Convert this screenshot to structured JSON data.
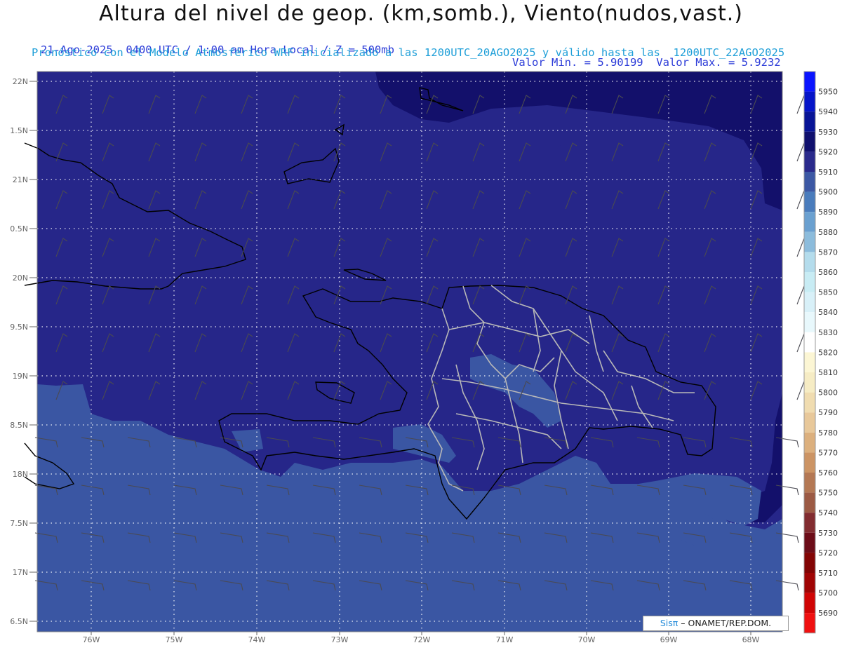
{
  "header": {
    "title": "Altura del nivel de geop. (km,somb.), Viento(nudos,vast.)",
    "left_info": "21-Ago-2025  0400 UTC / 1:00 am Hora Local / Z = 500mb",
    "right_info": "Valor Min. = 5.90199  Valor Max. = 5.9232",
    "model_info": "Pronóstico con el Modelo Atmosférico WRF inicializado a las 1200UTC_20AGO2025 y válido hasta las  1200UTC_22AGO2025"
  },
  "map": {
    "lat_labels": [
      "22N",
      "1.5N",
      "21N",
      "0.5N",
      "20N",
      "9.5N",
      "19N",
      "8.5N",
      "18N",
      "7.5N",
      "17N",
      "6.5N"
    ],
    "lon_labels": [
      "76W",
      "75W",
      "74W",
      "73W",
      "72W",
      "71W",
      "70W",
      "69W",
      "68W"
    ]
  },
  "colorbar": {
    "labels": [
      "5950",
      "5940",
      "5930",
      "5920",
      "5910",
      "5900",
      "5890",
      "5880",
      "5870",
      "5860",
      "5850",
      "5840",
      "5830",
      "5820",
      "5810",
      "5800",
      "5790",
      "5780",
      "5770",
      "5760",
      "5750",
      "5740",
      "5730",
      "5720",
      "5710",
      "5700",
      "5690"
    ],
    "colors": [
      "#0a14ff",
      "#0514c8",
      "#081496",
      "#10106e",
      "#2a2a8c",
      "#3c58a4",
      "#4a7cbc",
      "#6aa0d0",
      "#8cbcdc",
      "#b4dcec",
      "#c8ecf4",
      "#d8f0f8",
      "#e8f8fc",
      "#ffffff",
      "#fcf6d4",
      "#f6ecc4",
      "#f0dcb0",
      "#e8c89a",
      "#dcb07e",
      "#cc9464",
      "#b47854",
      "#9c5a44",
      "#822c30",
      "#6c0c18",
      "#820404",
      "#a00404",
      "#d00404",
      "#f01010"
    ]
  },
  "credit": {
    "sis": "Sisπ",
    "rest": " – ONAMET/REP.DOM."
  }
}
